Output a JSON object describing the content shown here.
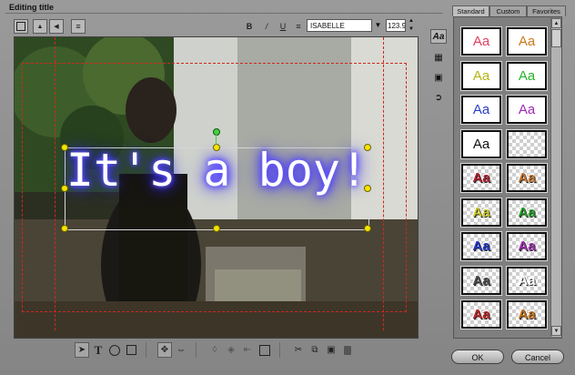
{
  "window": {
    "title": "Editing title"
  },
  "format_toolbar": {
    "bold": "B",
    "italic": "/",
    "underline": "U",
    "font": "ISABELLE",
    "font_size": "123.9"
  },
  "caption": {
    "text": "It's a boy!"
  },
  "gallery": {
    "tabs": [
      "Standard",
      "Custom",
      "Favorites"
    ],
    "active_tab": "Standard",
    "styles": [
      {
        "label": "Aa",
        "color": "#e04060",
        "bg": "white"
      },
      {
        "label": "Aa",
        "color": "#d07818",
        "bg": "white"
      },
      {
        "label": "Aa",
        "color": "#b4b414",
        "bg": "white"
      },
      {
        "label": "Aa",
        "color": "#28b428",
        "bg": "white"
      },
      {
        "label": "Aa",
        "color": "#2840c8",
        "bg": "white"
      },
      {
        "label": "Aa",
        "color": "#a028b4",
        "bg": "white"
      },
      {
        "label": "Aa",
        "color": "#111111",
        "bg": "white"
      },
      {
        "label": "",
        "color": "#111111",
        "bg": "check"
      },
      {
        "label": "Aa",
        "color": "#b42030",
        "bg": "check"
      },
      {
        "label": "Aa",
        "color": "#c87830",
        "bg": "check"
      },
      {
        "label": "Aa",
        "color": "#c8c828",
        "bg": "check"
      },
      {
        "label": "Aa",
        "color": "#28a028",
        "bg": "check"
      },
      {
        "label": "Aa",
        "color": "#2438c8",
        "bg": "check"
      },
      {
        "label": "Aa",
        "color": "#a030b0",
        "bg": "check"
      },
      {
        "label": "Aa",
        "color": "#505050",
        "bg": "check"
      },
      {
        "label": "Aa",
        "color": "#ffffff",
        "bg": "check"
      },
      {
        "label": "Aa",
        "color": "#c02828",
        "bg": "check"
      },
      {
        "label": "Aa",
        "color": "#c8741a",
        "bg": "check"
      }
    ]
  },
  "buttons": {
    "ok": "OK",
    "cancel": "Cancel"
  }
}
